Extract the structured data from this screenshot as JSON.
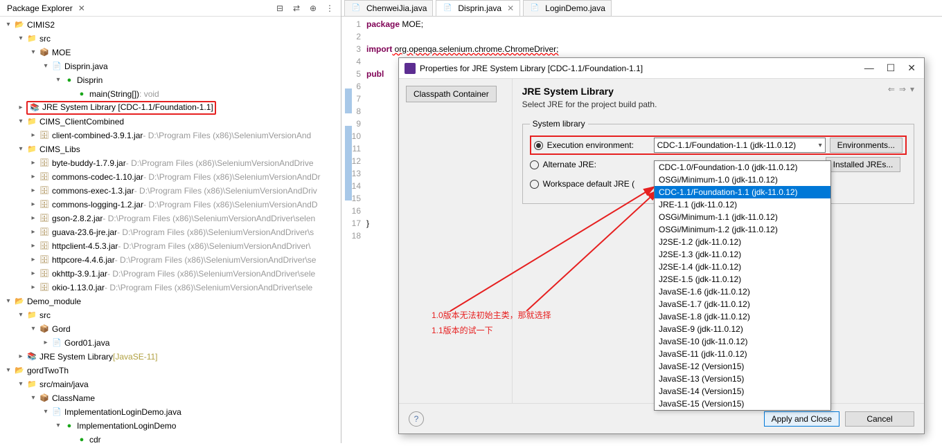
{
  "pe": {
    "title": "Package Explorer",
    "x": "✕"
  },
  "tree": [
    {
      "ind": 0,
      "tw": "▾",
      "ic": "ic-proj",
      "t": "📂",
      "label": "CIMIS2"
    },
    {
      "ind": 1,
      "tw": "▾",
      "ic": "ic-folder",
      "t": "📁",
      "label": "src"
    },
    {
      "ind": 2,
      "tw": "▾",
      "ic": "ic-pkg",
      "t": "📦",
      "label": "MOE"
    },
    {
      "ind": 3,
      "tw": "▾",
      "ic": "ic-java",
      "t": "📄",
      "label": "Disprin.java"
    },
    {
      "ind": 4,
      "tw": "▾",
      "ic": "ic-class",
      "t": "●",
      "label": "Disprin"
    },
    {
      "ind": 5,
      "tw": "",
      "ic": "ic-method",
      "t": "●",
      "label": "main(String[])",
      "typ": ": void"
    },
    {
      "ind": 1,
      "tw": "▸",
      "ic": "ic-lib",
      "t": "📚",
      "label": "JRE System Library [CDC-1.1/Foundation-1.1]",
      "hl": true
    },
    {
      "ind": 1,
      "tw": "▾",
      "ic": "ic-folder",
      "t": "📁",
      "label": "CIMS_ClientCombined"
    },
    {
      "ind": 2,
      "tw": "▸",
      "ic": "ic-jar",
      "t": "🗄",
      "label": "client-combined-3.9.1.jar",
      "path": " - D:\\Program Files (x86)\\SeleniumVersionAnd"
    },
    {
      "ind": 1,
      "tw": "▾",
      "ic": "ic-folder",
      "t": "📁",
      "label": "CIMS_Libs"
    },
    {
      "ind": 2,
      "tw": "▸",
      "ic": "ic-jar",
      "t": "🗄",
      "label": "byte-buddy-1.7.9.jar",
      "path": " - D:\\Program Files (x86)\\SeleniumVersionAndDrive"
    },
    {
      "ind": 2,
      "tw": "▸",
      "ic": "ic-jar",
      "t": "🗄",
      "label": "commons-codec-1.10.jar",
      "path": " - D:\\Program Files (x86)\\SeleniumVersionAndDr"
    },
    {
      "ind": 2,
      "tw": "▸",
      "ic": "ic-jar",
      "t": "🗄",
      "label": "commons-exec-1.3.jar",
      "path": " - D:\\Program Files (x86)\\SeleniumVersionAndDriv"
    },
    {
      "ind": 2,
      "tw": "▸",
      "ic": "ic-jar",
      "t": "🗄",
      "label": "commons-logging-1.2.jar",
      "path": " - D:\\Program Files (x86)\\SeleniumVersionAndD"
    },
    {
      "ind": 2,
      "tw": "▸",
      "ic": "ic-jar",
      "t": "🗄",
      "label": "gson-2.8.2.jar",
      "path": " - D:\\Program Files (x86)\\SeleniumVersionAndDriver\\selen"
    },
    {
      "ind": 2,
      "tw": "▸",
      "ic": "ic-jar",
      "t": "🗄",
      "label": "guava-23.6-jre.jar",
      "path": " - D:\\Program Files (x86)\\SeleniumVersionAndDriver\\s"
    },
    {
      "ind": 2,
      "tw": "▸",
      "ic": "ic-jar",
      "t": "🗄",
      "label": "httpclient-4.5.3.jar",
      "path": " - D:\\Program Files (x86)\\SeleniumVersionAndDriver\\"
    },
    {
      "ind": 2,
      "tw": "▸",
      "ic": "ic-jar",
      "t": "🗄",
      "label": "httpcore-4.4.6.jar",
      "path": " - D:\\Program Files (x86)\\SeleniumVersionAndDriver\\se"
    },
    {
      "ind": 2,
      "tw": "▸",
      "ic": "ic-jar",
      "t": "🗄",
      "label": "okhttp-3.9.1.jar",
      "path": " - D:\\Program Files (x86)\\SeleniumVersionAndDriver\\sele"
    },
    {
      "ind": 2,
      "tw": "▸",
      "ic": "ic-jar",
      "t": "🗄",
      "label": "okio-1.13.0.jar",
      "path": " - D:\\Program Files (x86)\\SeleniumVersionAndDriver\\sele"
    },
    {
      "ind": 0,
      "tw": "▾",
      "ic": "ic-proj",
      "t": "📂",
      "label": "Demo_module"
    },
    {
      "ind": 1,
      "tw": "▾",
      "ic": "ic-folder",
      "t": "📁",
      "label": "src"
    },
    {
      "ind": 2,
      "tw": "▾",
      "ic": "ic-pkg",
      "t": "📦",
      "label": "Gord"
    },
    {
      "ind": 3,
      "tw": "▸",
      "ic": "ic-java",
      "t": "📄",
      "label": "Gord01.java"
    },
    {
      "ind": 1,
      "tw": "▸",
      "ic": "ic-lib",
      "t": "📚",
      "label": "JRE System Library",
      "qual": " [JavaSE-11]"
    },
    {
      "ind": 0,
      "tw": "▾",
      "ic": "ic-proj",
      "t": "📂",
      "label": "gordTwoTh"
    },
    {
      "ind": 1,
      "tw": "▾",
      "ic": "ic-folder",
      "t": "📁",
      "label": "src/main/java"
    },
    {
      "ind": 2,
      "tw": "▾",
      "ic": "ic-pkg",
      "t": "📦",
      "label": "ClassName"
    },
    {
      "ind": 3,
      "tw": "▾",
      "ic": "ic-java",
      "t": "📄",
      "label": "ImplementationLoginDemo.java"
    },
    {
      "ind": 4,
      "tw": "▾",
      "ic": "ic-class",
      "t": "●",
      "label": "ImplementationLoginDemo"
    },
    {
      "ind": 5,
      "tw": "",
      "ic": "ic-method",
      "t": "●",
      "label": "cdr"
    }
  ],
  "tabs": [
    {
      "label": "ChenweiJia.java",
      "active": false
    },
    {
      "label": "Disprin.java",
      "active": true
    },
    {
      "label": "LoginDemo.java",
      "active": false
    }
  ],
  "code": {
    "lines": [
      "1",
      "2",
      "3",
      "4",
      "5",
      "6",
      "7",
      "8",
      "9",
      "10",
      "11",
      "12",
      "13",
      "14",
      "15",
      "16",
      "17",
      "18"
    ],
    "l1_kw": "package",
    "l1_rest": " MOE;",
    "l3_kw": "import",
    "l3_rest": " org.openqa.selenium.chrome.ChromeDriver;",
    "l5_kw": "publ",
    "l17": "}"
  },
  "dialog": {
    "title": "Properties for JRE System Library [CDC-1.1/Foundation-1.1]",
    "classpath_btn": "Classpath Container",
    "heading": "JRE System Library",
    "sub": "Select JRE for the project build path.",
    "legend": "System library",
    "r1": "Execution environment:",
    "r2": "Alternate JRE:",
    "r3": "Workspace default JRE (",
    "combo_val": "CDC-1.1/Foundation-1.1 (jdk-11.0.12)",
    "env_btn": "Environments...",
    "jre_btn": "Installed JREs...",
    "apply": "Apply and Close",
    "cancel": "Cancel"
  },
  "dropdown": [
    "CDC-1.0/Foundation-1.0 (jdk-11.0.12)",
    "OSGi/Minimum-1.0 (jdk-11.0.12)",
    "CDC-1.1/Foundation-1.1 (jdk-11.0.12)",
    "JRE-1.1 (jdk-11.0.12)",
    "OSGi/Minimum-1.1 (jdk-11.0.12)",
    "OSGi/Minimum-1.2 (jdk-11.0.12)",
    "J2SE-1.2 (jdk-11.0.12)",
    "J2SE-1.3 (jdk-11.0.12)",
    "J2SE-1.4 (jdk-11.0.12)",
    "J2SE-1.5 (jdk-11.0.12)",
    "JavaSE-1.6 (jdk-11.0.12)",
    "JavaSE-1.7 (jdk-11.0.12)",
    "JavaSE-1.8 (jdk-11.0.12)",
    "JavaSE-9 (jdk-11.0.12)",
    "JavaSE-10 (jdk-11.0.12)",
    "JavaSE-11 (jdk-11.0.12)",
    "JavaSE-12 (Version15)",
    "JavaSE-13 (Version15)",
    "JavaSE-14 (Version15)",
    "JavaSE-15 (Version15)"
  ],
  "annotation": {
    "l1": "1.0版本无法初始主类，那就选择",
    "l2": "1.1版本的试一下"
  }
}
